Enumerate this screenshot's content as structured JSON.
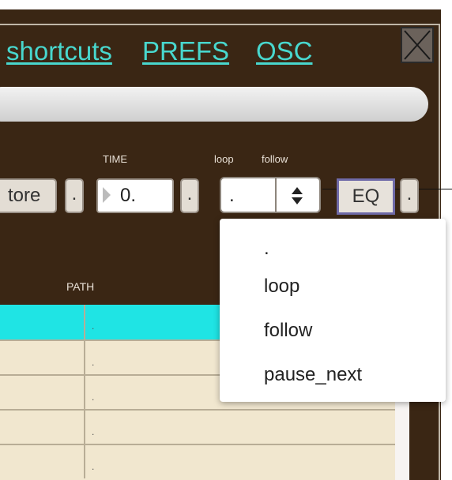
{
  "toolbar": {
    "links": [
      "shortcuts",
      "PREFS",
      "OSC"
    ]
  },
  "controls": {
    "time_label": "TIME",
    "loop_label": "loop",
    "follow_label": "follow",
    "restore_label": "tore",
    "time_value": "0.",
    "dot": ".",
    "mode_value": ".",
    "eq_label": "EQ"
  },
  "table": {
    "column_header": "PATH",
    "rows": [
      {
        "path": "."
      },
      {
        "path": "."
      },
      {
        "path": "."
      },
      {
        "path": "."
      },
      {
        "path": "."
      }
    ]
  },
  "dropdown": {
    "options": [
      ".",
      "loop",
      "follow",
      "pause_next"
    ]
  },
  "colors": {
    "panel": "#3a2614",
    "link": "#48d7ce",
    "selected_row": "#1fe4e4",
    "table_bg": "#f1e7cf"
  }
}
